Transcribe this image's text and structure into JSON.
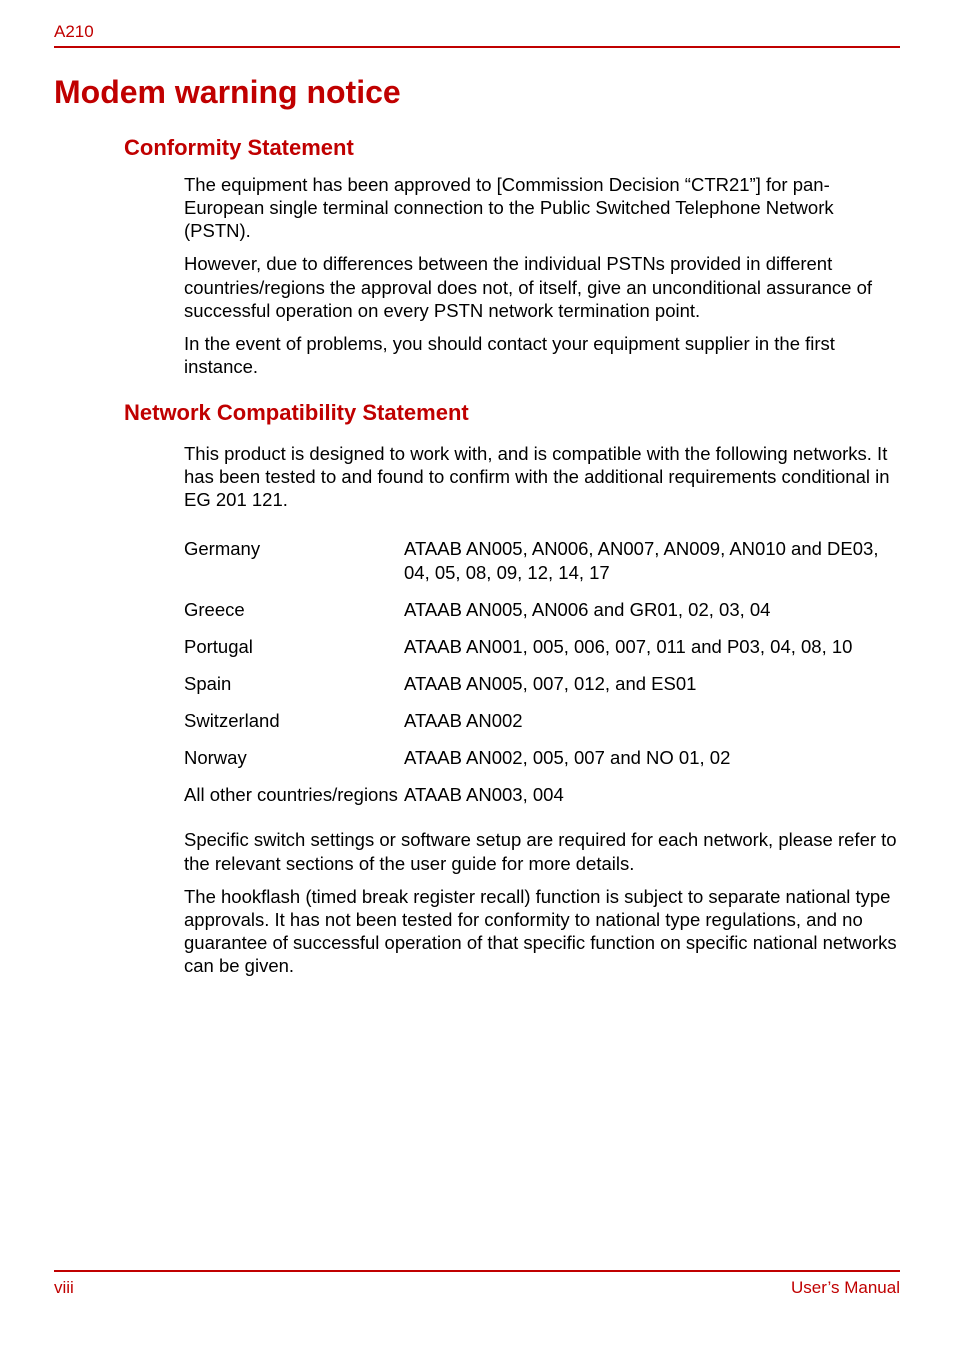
{
  "header": {
    "model": "A210"
  },
  "title": "Modem warning notice",
  "conformity": {
    "heading": "Conformity Statement",
    "p1": "The equipment has been approved to [Commission Decision “CTR21”] for pan- European single terminal connection to the Public Switched Telephone Network (PSTN).",
    "p2": "However, due to differences between the individual PSTNs provided in different countries/regions the approval does not, of itself, give an unconditional assurance of successful operation on every PSTN network termination point.",
    "p3": "In the event of problems, you should contact your equipment supplier in the first instance."
  },
  "network": {
    "heading": "Network Compatibility Statement",
    "intro": "This product is designed to work with, and is compatible with the following networks. It has been tested to and found to confirm with the additional requirements conditional in EG 201 121.",
    "rows": [
      {
        "country": "Germany",
        "codes": "ATAAB AN005, AN006, AN007, AN009, AN010 and DE03, 04, 05, 08, 09, 12, 14, 17"
      },
      {
        "country": "Greece",
        "codes": "ATAAB AN005, AN006 and GR01, 02, 03, 04"
      },
      {
        "country": "Portugal",
        "codes": "ATAAB AN001, 005, 006, 007, 011 and P03, 04, 08, 10"
      },
      {
        "country": "Spain",
        "codes": "ATAAB AN005, 007, 012, and ES01"
      },
      {
        "country": "Switzerland",
        "codes": "ATAAB AN002"
      },
      {
        "country": "Norway",
        "codes": "ATAAB AN002, 005, 007 and NO 01, 02"
      },
      {
        "country": "All other countries/regions",
        "codes": "ATAAB AN003, 004"
      }
    ],
    "p_after1": "Specific switch settings or software setup are required for each network, please refer to the relevant sections of the user guide for more details.",
    "p_after2": "The hookflash (timed break register recall) function is subject to separate national type approvals. It has not been tested for conformity to national type regulations, and no guarantee of successful operation of that specific function on specific national networks can be given."
  },
  "footer": {
    "page": "viii",
    "label": "User’s Manual"
  }
}
